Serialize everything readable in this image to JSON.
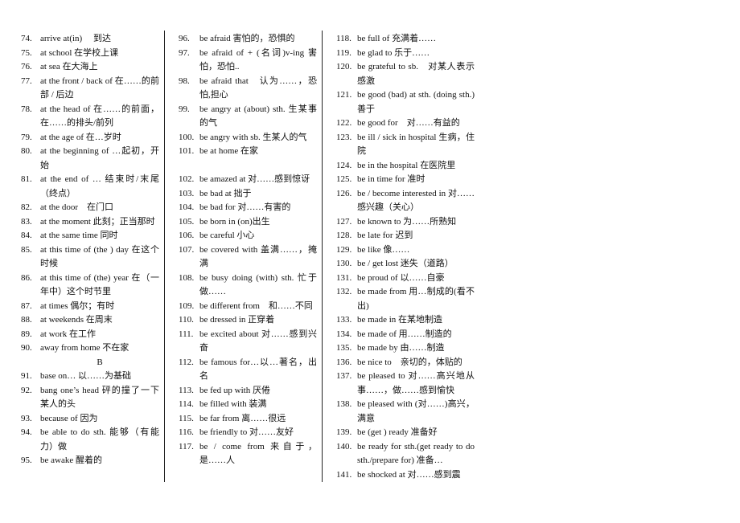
{
  "columns": [
    {
      "entries": [
        {
          "num": "74.",
          "text": "arrive at(in)　 到达"
        },
        {
          "num": "75.",
          "text": "at school 在学校上课"
        },
        {
          "num": "76.",
          "text": "at sea 在大海上"
        },
        {
          "num": "77.",
          "text": "at the front / back of 在……的前部 / 后边"
        },
        {
          "num": "78.",
          "text": "at the head of 在……的前面，在……的排头/前列"
        },
        {
          "num": "79.",
          "text": "at the age of 在…岁时"
        },
        {
          "num": "80.",
          "text": "at the beginning of …起初，开始"
        },
        {
          "num": "81.",
          "text": "at the end of … 结束时/末尾（终点）"
        },
        {
          "num": "82.",
          "text": "at the door　在门口"
        },
        {
          "num": "83.",
          "text": "at the moment 此刻；正当那时"
        },
        {
          "num": "84.",
          "text": "at the same time 同时"
        },
        {
          "num": "85.",
          "text": "at this time of (the ) day 在这个时候"
        },
        {
          "num": "86.",
          "text": "at this time of (the) year 在（一年中）这个时节里"
        },
        {
          "num": "87.",
          "text": "at times 偶尔；有时"
        },
        {
          "num": "88.",
          "text": "at weekends 在周末"
        },
        {
          "num": "89.",
          "text": "at work 在工作"
        },
        {
          "num": "90.",
          "text": "away from home 不在家"
        }
      ],
      "section_heading": "B",
      "entries_after": [
        {
          "num": "91.",
          "text": "base on… 以……为基础"
        },
        {
          "num": "92.",
          "text": "bang one’s head 砰的撞了一下某人的头"
        },
        {
          "num": "93.",
          "text": "because of 因为"
        },
        {
          "num": "94.",
          "text": "be able to do sth. 能够（有能力）做"
        },
        {
          "num": "95.",
          "text": "be awake 醒着的"
        }
      ]
    },
    {
      "entries": [
        {
          "num": "96.",
          "text": "be afraid 害怕的，恐惧的"
        },
        {
          "num": "97.",
          "text": "be afraid of + (名词)v-ing 害怕，恐怕.."
        },
        {
          "num": "98.",
          "text": "be afraid that　认为……，恐怕,担心"
        },
        {
          "num": "99.",
          "text": "be angry at (about) sth. 生某事的气"
        },
        {
          "num": "100.",
          "text": "be angry with sb. 生某人的气"
        },
        {
          "num": "101.",
          "text": "be at home 在家"
        }
      ],
      "entries_after": [
        {
          "num": "102.",
          "text": "be amazed at 对……感到惊讶"
        },
        {
          "num": "103.",
          "text": "be bad at 拙于"
        },
        {
          "num": "104.",
          "text": "be bad for 对……有害的"
        },
        {
          "num": "105.",
          "text": "be born in (on)出生"
        },
        {
          "num": "106.",
          "text": "be careful 小心"
        },
        {
          "num": "107.",
          "text": "be covered with 盖满……，掩满"
        },
        {
          "num": "108.",
          "text": "be busy doing (with) sth. 忙于做……"
        },
        {
          "num": "109.",
          "text": "be different from　和……不同"
        },
        {
          "num": "110.",
          "text": "be dressed in 正穿着"
        },
        {
          "num": "111.",
          "text": "be excited about 对……感到兴奋"
        },
        {
          "num": "112.",
          "text": "be famous for…以…著名，出名"
        },
        {
          "num": "113.",
          "text": "be fed up with 厌倦"
        },
        {
          "num": "114.",
          "text": "be filled with 装满"
        },
        {
          "num": "115.",
          "text": "be far from 离……很远"
        },
        {
          "num": "116.",
          "text": "be friendly to 对……友好"
        },
        {
          "num": "117.",
          "text": "be / come from 来自于，是……人"
        }
      ]
    },
    {
      "entries": [
        {
          "num": "118.",
          "text": "be full of 充满着……"
        },
        {
          "num": "119.",
          "text": "be glad to 乐于……"
        },
        {
          "num": "120.",
          "text": "be grateful to sb.　对某人表示感激"
        },
        {
          "num": "121.",
          "text": "be good (bad) at sth. (doing sth.) 善于"
        },
        {
          "num": "122.",
          "text": "be good for　对……有益的"
        },
        {
          "num": "123.",
          "text": "be ill / sick in hospital 生病，住院"
        },
        {
          "num": "124.",
          "text": "be in the hospital 在医院里"
        },
        {
          "num": "125.",
          "text": "be in time for 准时"
        },
        {
          "num": "126.",
          "text": "be / become interested in 对……感兴趣（关心）"
        },
        {
          "num": "127.",
          "text": "be known to 为……所熟知"
        },
        {
          "num": "128.",
          "text": "be late for 迟到"
        },
        {
          "num": "129.",
          "text": "be like 像……"
        },
        {
          "num": "130.",
          "text": "be / get lost 迷失（道路）"
        },
        {
          "num": "131.",
          "text": "be proud of 以……自豪"
        },
        {
          "num": "132.",
          "text": "be made from 用…制成的(看不出)"
        },
        {
          "num": "133.",
          "text": "be made in 在某地制造"
        },
        {
          "num": "134.",
          "text": "be made of 用……制造的"
        },
        {
          "num": "135.",
          "text": "be made by 由……制造"
        },
        {
          "num": "136.",
          "text": "be nice to　亲切的，体贴的"
        },
        {
          "num": "137.",
          "text": "be pleased to 对……高兴地从事……，做……感到愉快"
        },
        {
          "num": "138.",
          "text": "be pleased with (对……)高兴，满意"
        },
        {
          "num": "139.",
          "text": "be (get ) ready 准备好"
        },
        {
          "num": "140.",
          "text": "be ready for sth.(get ready to do sth./prepare for) 准备…"
        },
        {
          "num": "141.",
          "text": "be shocked at 对……感到震"
        }
      ]
    }
  ]
}
